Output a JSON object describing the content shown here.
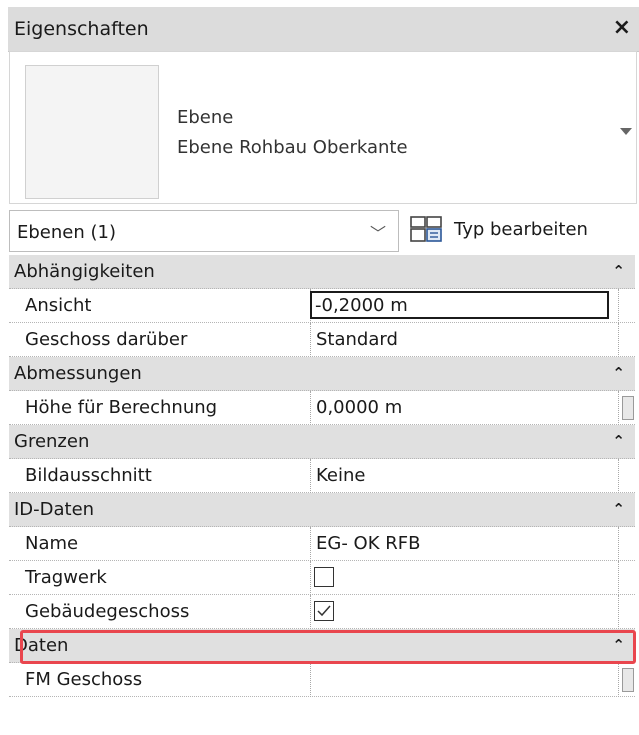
{
  "panel": {
    "title": "Eigenschaften",
    "close_symbol": "×"
  },
  "type_selector": {
    "family": "Ebene",
    "type": "Ebene Rohbau Oberkante"
  },
  "instance_filter": {
    "label": "Ebenen (1)",
    "chevron": "﹀"
  },
  "edit_type": {
    "label": "Typ bearbeiten"
  },
  "rows": [
    {
      "kind": "category",
      "name": "Abhängigkeiten",
      "collapse": "⌃"
    },
    {
      "kind": "param",
      "name": "Ansicht",
      "value": "-0,2000 m",
      "editing": true
    },
    {
      "kind": "param",
      "name": "Geschoss darüber",
      "value": "Standard"
    },
    {
      "kind": "category",
      "name": "Abmessungen",
      "collapse": "⌃"
    },
    {
      "kind": "param",
      "name": "Höhe für Berechnung",
      "value": "0,0000 m",
      "slider": true
    },
    {
      "kind": "category",
      "name": "Grenzen",
      "collapse": "⌃"
    },
    {
      "kind": "param",
      "name": "Bildausschnitt",
      "value": "Keine"
    },
    {
      "kind": "category",
      "name": "ID-Daten",
      "collapse": "⌃"
    },
    {
      "kind": "param",
      "name": "Name",
      "value": "EG- OK RFB"
    },
    {
      "kind": "param",
      "name": "Tragwerk",
      "checkbox": true,
      "checked": false
    },
    {
      "kind": "param",
      "name": "Gebäudegeschoss",
      "checkbox": true,
      "checked": true,
      "highlighted": true
    },
    {
      "kind": "category",
      "name": "Daten",
      "collapse": "⌃"
    },
    {
      "kind": "param",
      "name": "FM Geschoss",
      "value": "",
      "slider": true
    }
  ],
  "colors": {
    "highlight": "#e9464e",
    "category_bg": "#e0e0e0",
    "titlebar_bg": "#dcdcdc"
  }
}
